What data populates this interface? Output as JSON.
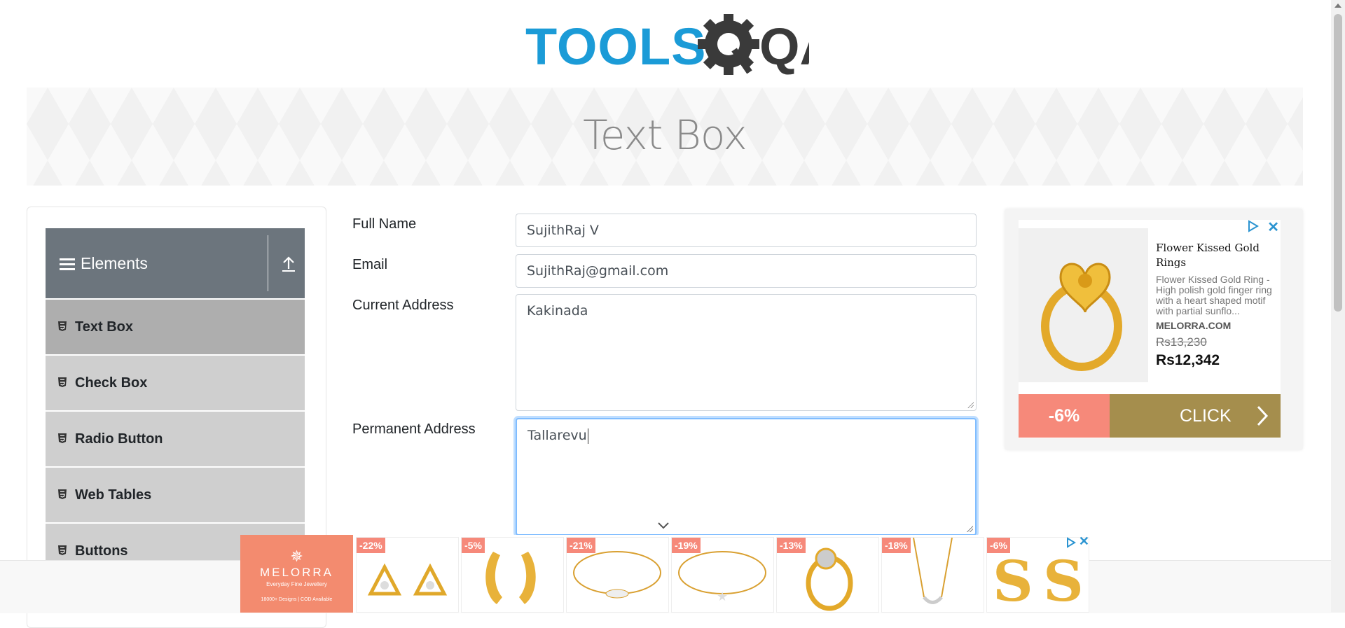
{
  "brand": {
    "logo_text_tools": "TOOLS",
    "logo_text_qa": "QA"
  },
  "banner": {
    "title": "Text Box"
  },
  "sidebar": {
    "group_label": "Elements",
    "items": [
      {
        "label": "Text Box",
        "active": true
      },
      {
        "label": "Check Box",
        "active": false
      },
      {
        "label": "Radio Button",
        "active": false
      },
      {
        "label": "Web Tables",
        "active": false
      },
      {
        "label": "Buttons",
        "active": false
      }
    ]
  },
  "form": {
    "full_name_label": "Full Name",
    "full_name_value": "SujithRaj V",
    "email_label": "Email",
    "email_value": "SujithRaj@gmail.com",
    "current_address_label": "Current Address",
    "current_address_value": "Kakinada",
    "permanent_address_label": "Permanent Address",
    "permanent_address_value": "Tallarevu"
  },
  "side_ad": {
    "title": "Flower Kissed Gold Rings",
    "description": "Flower Kissed Gold Ring - High polish gold finger ring with a heart shaped motif with partial sunflo...",
    "brand": "MELORRA.COM",
    "old_price": "Rs13,230",
    "new_price": "Rs12,342",
    "discount": "-6%",
    "cta": "CLICK",
    "colors": {
      "discount": "#f6897a",
      "cta": "#a58e4d"
    }
  },
  "bottom_ad": {
    "brand_name": "MELORRA",
    "brand_tagline": "Everyday Fine Jewellery",
    "brand_footer": "18000+ Designs | COD Available",
    "products": [
      {
        "discount": "-22%",
        "kind": "triangle-earrings"
      },
      {
        "discount": "-5%",
        "kind": "hoop-earrings"
      },
      {
        "discount": "-21%",
        "kind": "eye-bracelet"
      },
      {
        "discount": "-19%",
        "kind": "star-bracelet"
      },
      {
        "discount": "-13%",
        "kind": "solitaire-ring"
      },
      {
        "discount": "-18%",
        "kind": "pendant-necklace"
      },
      {
        "discount": "-6%",
        "kind": "s-earrings"
      }
    ]
  },
  "colors": {
    "accent_blue": "#1b9bd7",
    "gear_dark": "#3a3a3a",
    "sidebar_header": "#6c757d"
  }
}
